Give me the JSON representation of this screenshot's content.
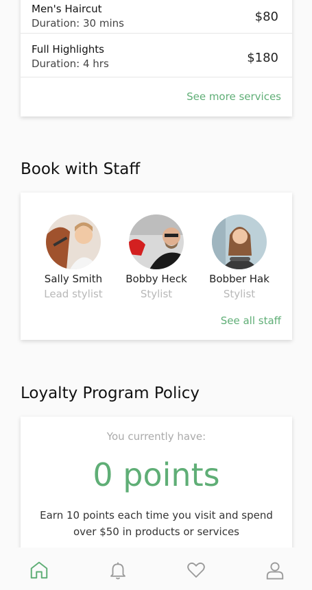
{
  "services": {
    "items": [
      {
        "name": "Men's Haircut",
        "duration": "Duration: 30 mins",
        "price": "$80"
      },
      {
        "name": "Full Highlights",
        "duration": "Duration: 4 hrs",
        "price": "$180"
      }
    ],
    "see_more": "See more services"
  },
  "staff_section": {
    "title": "Book with Staff",
    "members": [
      {
        "name": "Sally Smith",
        "role": "Lead stylist"
      },
      {
        "name": "Bobby Heck",
        "role": "Stylist"
      },
      {
        "name": "Bobber Hak",
        "role": "Stylist"
      }
    ],
    "see_all": "See all staff"
  },
  "loyalty": {
    "title": "Loyalty Program Policy",
    "label": "You currently have:",
    "points": "0 points",
    "description": "Earn 10 points each time you visit and spend over $50 in products or services"
  },
  "nav": {
    "items": [
      "home-icon",
      "bell-icon",
      "heart-icon",
      "user-icon"
    ],
    "active_color": "#5fae76",
    "inactive_color": "#9a9a9a"
  },
  "colors": {
    "accent": "#5fae76"
  }
}
